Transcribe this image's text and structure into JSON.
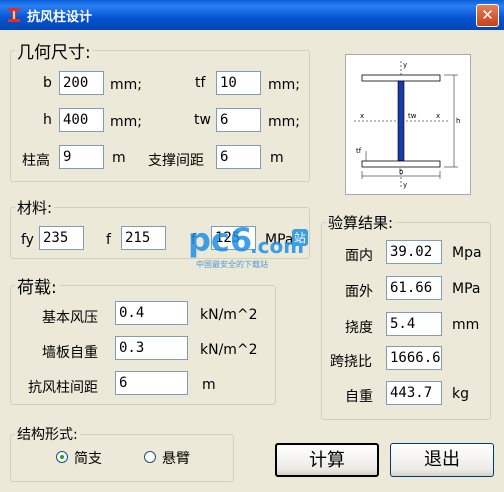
{
  "window": {
    "title": "抗风柱设计",
    "close_glyph": "✕"
  },
  "geometry": {
    "legend": "几何尺寸:",
    "b_label": "b",
    "b_value": "200",
    "b_unit": "mm;",
    "h_label": "h",
    "h_value": "400",
    "h_unit": "mm;",
    "tf_label": "tf",
    "tf_value": "10",
    "tf_unit": "mm;",
    "tw_label": "tw",
    "tw_value": "6",
    "tw_unit": "mm;",
    "col_height_label": "柱高",
    "col_height_value": "9",
    "col_height_unit": "m",
    "brace_spacing_label": "支撑间距",
    "brace_spacing_value": "6",
    "brace_spacing_unit": "m"
  },
  "section_diagram": {
    "y_top": "y",
    "y_bottom": "y",
    "x_left": "x",
    "x_right": "x",
    "tw": "tw",
    "tf": "tf",
    "h": "h",
    "b": "b"
  },
  "material": {
    "legend": "材料:",
    "fy_label": "fy",
    "fy_value": "235",
    "f_label": "f",
    "f_value": "215",
    "fv_label": "f",
    "fv_value": "125",
    "fv_unit": "MPa"
  },
  "load": {
    "legend": "荷载:",
    "wind_label": "基本风压",
    "wind_value": "0.4",
    "wind_unit": "kN/m^2",
    "wall_label": "墙板自重",
    "wall_value": "0.3",
    "wall_unit": "kN/m^2",
    "spacing_label": "抗风柱间距",
    "spacing_value": "6",
    "spacing_unit": "m"
  },
  "structure": {
    "legend": "结构形式:",
    "option1": "简支",
    "option2": "悬臂",
    "selected": "简支"
  },
  "results": {
    "legend": "验算结果:",
    "in_plane_label": "面内",
    "in_plane_value": "39.02",
    "in_plane_unit": "Mpa",
    "out_plane_label": "面外",
    "out_plane_value": "61.66",
    "out_plane_unit": "MPa",
    "deflection_label": "挠度",
    "deflection_value": "5.4",
    "deflection_unit": "mm",
    "span_ratio_label": "跨挠比",
    "span_ratio_value": "1666.6",
    "weight_label": "自重",
    "weight_value": "443.7",
    "weight_unit": "kg"
  },
  "buttons": {
    "calc": "计算",
    "exit": "退出"
  },
  "watermark": {
    "brand_main": "pc6",
    "brand_suffix": ".com",
    "brand_tag": "站",
    "slogan": "中国最安全的下载站"
  },
  "colors": {
    "title_bar": "#0553d0",
    "window_bg": "#ece9d8",
    "accent_green": "#21a121",
    "watermark_blue": "#1e90e6"
  }
}
